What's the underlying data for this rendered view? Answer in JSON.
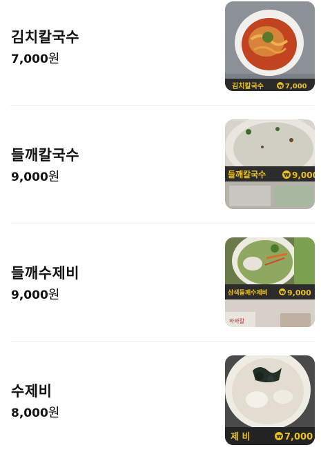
{
  "menu": {
    "items": [
      {
        "name": "김치칼국수",
        "price": "7,000",
        "unit": "원",
        "photo_label": "김치칼국수",
        "photo_price": "7,000"
      },
      {
        "name": "들깨칼국수",
        "price": "9,000",
        "unit": "원",
        "photo_label": "들깨칼국수",
        "photo_price": "9,000"
      },
      {
        "name": "들깨수제비",
        "price": "9,000",
        "unit": "원",
        "photo_label": "삼색들깨수제비",
        "photo_price": "9,000",
        "photo_sub": "와와칼"
      },
      {
        "name": "수제비",
        "price": "8,000",
        "unit": "원",
        "photo_label": "제 비",
        "photo_price": "7,000"
      }
    ],
    "won_symbol": "₩"
  }
}
